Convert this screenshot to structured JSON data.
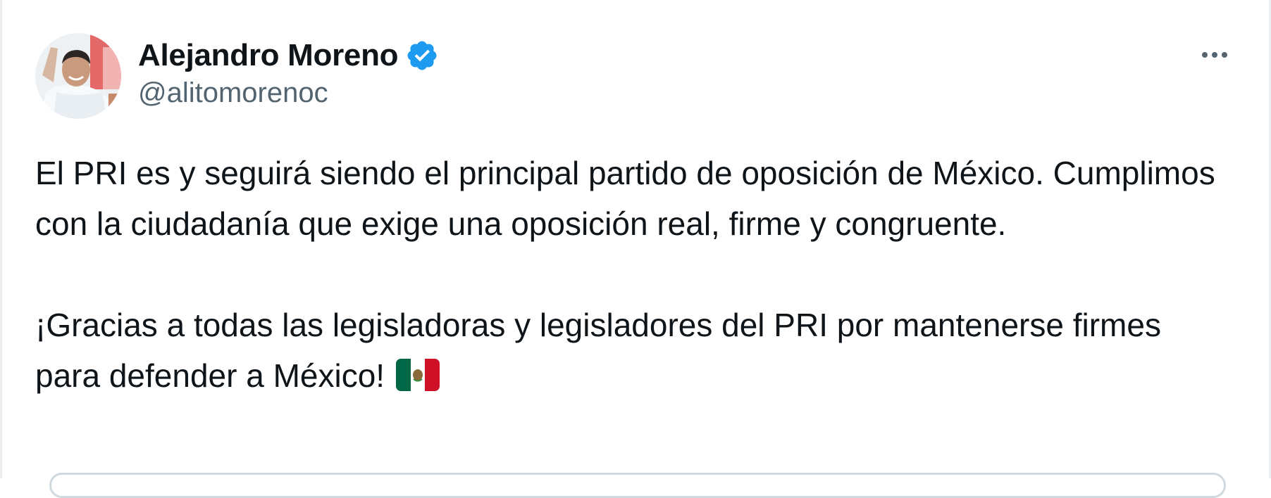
{
  "author": {
    "display_name": "Alejandro Moreno",
    "handle": "@alitomorenoc",
    "verified": true,
    "verified_badge_icon": "verified-badge-icon",
    "avatar_icon": "profile-photo"
  },
  "tweet": {
    "paragraph1": "El PRI es y seguirá siendo el principal partido de oposición de México. Cumplimos con la ciudadanía que exige una oposición real, firme y congruente.",
    "paragraph2": "¡Gracias a todas las legisladoras y legisladores del PRI por mantenerse firmes para defender a México!",
    "emoji_icon": "mexico-flag-emoji"
  },
  "menu": {
    "icon": "more-options-icon"
  },
  "colors": {
    "text_primary": "#0f1419",
    "text_secondary": "#536471",
    "verified_blue": "#1d9bf0",
    "border": "#cfd9de"
  }
}
